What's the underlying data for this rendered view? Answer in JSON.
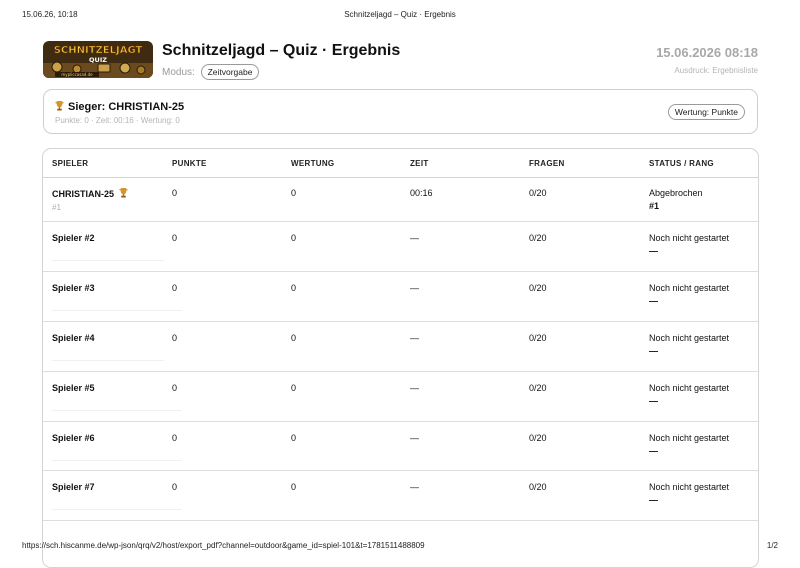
{
  "print": {
    "header_left": "15.06.26, 10:18",
    "header_center": "Schnitzeljagd – Quiz · Ergebnis",
    "footer_url": "https://sch.hiscanme.de/wp-json/qrq/v2/host/export_pdf?channel=outdoor&game_id=spiel-101&t=1781511488809",
    "footer_page": "1/2"
  },
  "logo": {
    "line1": "SCHNITZELJAGT",
    "line2": "QUIZ",
    "url": "mypliccasad.de"
  },
  "header": {
    "title": "Schnitzeljagd – Quiz · Ergebnis",
    "mode_label": "Modus:",
    "mode_value": "Zeitvorgabe",
    "datetime": "15.06.2026 08:18",
    "print_note": "Ausdruck: Ergebnisliste"
  },
  "winner": {
    "title": "Sieger: CHRISTIAN-25",
    "meta": "Punkte: 0 · Zeit: 00:16 · Wertung: 0",
    "scoring_badge": "Wertung: Punkte"
  },
  "table": {
    "columns": [
      "SPIELER",
      "PUNKTE",
      "WERTUNG",
      "ZEIT",
      "FRAGEN",
      "STATUS / RANG"
    ],
    "rows": [
      {
        "name": "CHRISTIAN-25",
        "sub": "#1",
        "points": "0",
        "rating": "0",
        "time": "00:16",
        "questions": "0/20",
        "status": "Abgebrochen",
        "rank": "#1"
      },
      {
        "name": "Spieler #2",
        "sub": "",
        "points": "0",
        "rating": "0",
        "time": "—",
        "questions": "0/20",
        "status": "Noch nicht gestartet",
        "rank": "—"
      },
      {
        "name": "Spieler #3",
        "sub": "",
        "points": "0",
        "rating": "0",
        "time": "—",
        "questions": "0/20",
        "status": "Noch nicht gestartet",
        "rank": "—"
      },
      {
        "name": "Spieler #4",
        "sub": "",
        "points": "0",
        "rating": "0",
        "time": "—",
        "questions": "0/20",
        "status": "Noch nicht gestartet",
        "rank": "—"
      },
      {
        "name": "Spieler #5",
        "sub": "",
        "points": "0",
        "rating": "0",
        "time": "—",
        "questions": "0/20",
        "status": "Noch nicht gestartet",
        "rank": "—"
      },
      {
        "name": "Spieler #6",
        "sub": "",
        "points": "0",
        "rating": "0",
        "time": "—",
        "questions": "0/20",
        "status": "Noch nicht gestartet",
        "rank": "—"
      },
      {
        "name": "Spieler #7",
        "sub": "",
        "points": "0",
        "rating": "0",
        "time": "—",
        "questions": "0/20",
        "status": "Noch nicht gestartet",
        "rank": "—"
      }
    ]
  },
  "colors": {
    "accent_trophy": "#d4952a",
    "muted_text": "#b0b0b0",
    "border": "#d4d4d4"
  }
}
